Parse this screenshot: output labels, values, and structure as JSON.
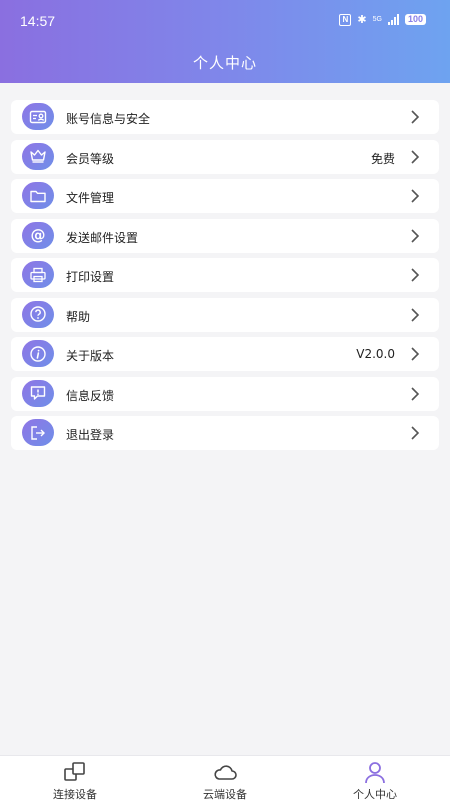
{
  "status_bar": {
    "time": "14:57",
    "network": "5G",
    "battery": "100"
  },
  "header": {
    "title": "个人中心"
  },
  "menu": {
    "items": [
      {
        "label": "账号信息与安全",
        "value": "",
        "icon": "id-card-icon"
      },
      {
        "label": "会员等级",
        "value": "免费",
        "icon": "crown-icon"
      },
      {
        "label": "文件管理",
        "value": "",
        "icon": "folder-icon"
      },
      {
        "label": "发送邮件设置",
        "value": "",
        "icon": "at-icon"
      },
      {
        "label": "打印设置",
        "value": "",
        "icon": "printer-icon"
      },
      {
        "label": "帮助",
        "value": "",
        "icon": "help-icon"
      },
      {
        "label": "关于版本",
        "value": "V2.0.0",
        "icon": "info-icon"
      },
      {
        "label": "信息反馈",
        "value": "",
        "icon": "feedback-icon"
      },
      {
        "label": "退出登录",
        "value": "",
        "icon": "logout-icon"
      }
    ]
  },
  "tabbar": {
    "tabs": [
      {
        "label": "连接设备",
        "icon": "connect-devices-icon"
      },
      {
        "label": "云端设备",
        "icon": "cloud-icon"
      },
      {
        "label": "个人中心",
        "icon": "person-icon"
      }
    ],
    "active_index": 2
  },
  "colors": {
    "header_gradient_start": "#8a6fe0",
    "header_gradient_end": "#6ea3f0",
    "icon_gradient_start": "#8f75e6",
    "icon_gradient_end": "#6f8fe8",
    "background": "#f4f4f6",
    "active_tab": "#8b6fe0"
  }
}
